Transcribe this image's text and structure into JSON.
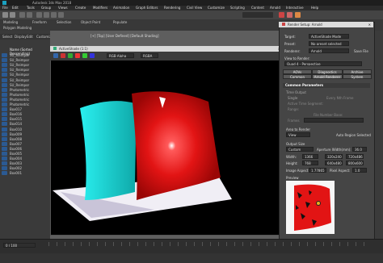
{
  "app": {
    "title": "Autodesk 3ds Max 2018"
  },
  "menu": [
    "File",
    "Edit",
    "Tools",
    "Group",
    "Views",
    "Create",
    "Modifiers",
    "Animation",
    "Graph Editors",
    "Rendering",
    "Civil View",
    "Customize",
    "Scripting",
    "Content",
    "Arnold",
    "Interactive",
    "Help"
  ],
  "ribbon": {
    "tabs": [
      "Modeling",
      "Freeform",
      "Selection",
      "Object Paint",
      "Populate"
    ],
    "sub": "Polygon Modeling"
  },
  "scene_explorer": {
    "tabs": [
      "Select",
      "Display",
      "Edit",
      "Customize"
    ],
    "header": "Name (Sorted Descending)",
    "items": [
      "SU_Reimpor",
      "SU_Reimpor",
      "SU_Reimpor",
      "SU_Reimpor",
      "SU_Reimpor",
      "SU_Reimpor",
      "SU_Reimpor",
      "Photometric",
      "Photometric",
      "Photometric",
      "Photometric",
      "Box017",
      "Box016",
      "Box015",
      "Box014",
      "Box010",
      "Box009",
      "Box008",
      "Box007",
      "Box006",
      "Box005",
      "Box004",
      "Box003",
      "Box002",
      "Box001"
    ]
  },
  "viewport": {
    "label": "[+] [Top] [User Defined] [Default Shading]"
  },
  "activeshade": {
    "title": "ActiveShade (1:1)",
    "channel": "RGB Alpha",
    "display": "RGBA"
  },
  "render_setup": {
    "title": "Render Setup: Arnold",
    "target_label": "Target:",
    "target_value": "ActiveShade Mode",
    "preset_label": "Preset:",
    "preset_value": "No preset selected",
    "renderer_label": "Renderer:",
    "renderer_value": "Arnold",
    "save_file": "Save File",
    "view_label": "View to Render:",
    "view_value": "Quad 4 - Perspective",
    "tabs_row1": [
      "AOVs",
      "Diagnostics",
      "Archive"
    ],
    "tabs_row2": [
      "Common",
      "Arnold Renderer",
      "System"
    ],
    "common_params": "Common Parameters",
    "time_output": "Time Output",
    "single": "Single",
    "every_nth": "Every Nth Frame",
    "active_segment": "Active Time Segment:",
    "range": "Range:",
    "frames": "Frames",
    "file_number_base": "File Number Base:",
    "area_to_render": "Area to Render",
    "area_value": "View",
    "auto_region": "Auto Region Selected",
    "output_size": "Output Size",
    "output_value": "Custom",
    "aperture_label": "Aperture Width(mm):",
    "aperture_value": "36.0",
    "width_label": "Width:",
    "width_value": "1366",
    "height_label": "Height:",
    "height_value": "768",
    "image_aspect_label": "Image Aspect:",
    "image_aspect_value": "1.77865",
    "pixel_aspect_label": "Pixel Aspect:",
    "pixel_aspect_value": "1.0",
    "presets": [
      "320x240",
      "720x486",
      "640x480",
      "800x600"
    ],
    "preview_label": "Preview"
  },
  "timeline": {
    "frame": "0 / 100"
  },
  "colors": {
    "cyan_panel": "#1fe0e0",
    "red_panel": "#e21414",
    "floor": "#f0eef5",
    "accent": "#2b5a93"
  }
}
